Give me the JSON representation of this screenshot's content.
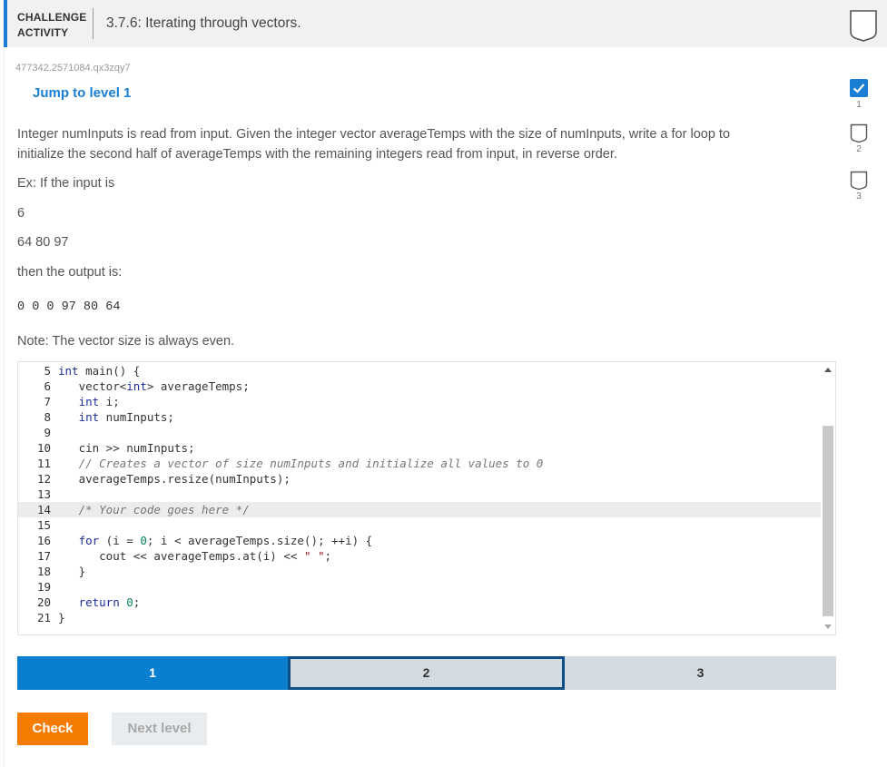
{
  "header": {
    "tag_line1": "CHALLENGE",
    "tag_line2": "ACTIVITY",
    "title": "3.7.6: Iterating through vectors."
  },
  "activity_id": "477342.2571084.qx3zqy7",
  "jump_link": "Jump to level 1",
  "instructions": {
    "p1_line1": "Integer numInputs is read from input. Given the integer vector averageTemps with the size of numInputs, write a for loop to",
    "p1_line2": "initialize the second half of averageTemps with the remaining integers read from input, in reverse order.",
    "example_intro": "Ex: If the input is",
    "input_line1": "6",
    "input_line2": "64 80 97",
    "output_intro": "then the output is:",
    "output_value": "0 0 0 97 80 64",
    "note": "Note: The vector size is always even."
  },
  "code_lines": [
    {
      "n": "5",
      "code": "int main() {"
    },
    {
      "n": "6",
      "code": "   vector<int> averageTemps;"
    },
    {
      "n": "7",
      "code": "   int i;"
    },
    {
      "n": "8",
      "code": "   int numInputs;"
    },
    {
      "n": "9",
      "code": ""
    },
    {
      "n": "10",
      "code": "   cin >> numInputs;"
    },
    {
      "n": "11",
      "code": "   // Creates a vector of size numInputs and initialize all values to 0"
    },
    {
      "n": "12",
      "code": "   averageTemps.resize(numInputs);"
    },
    {
      "n": "13",
      "code": ""
    },
    {
      "n": "14",
      "code": "   /* Your code goes here */"
    },
    {
      "n": "15",
      "code": ""
    },
    {
      "n": "16",
      "code": "   for (i = 0; i < averageTemps.size(); ++i) {"
    },
    {
      "n": "17",
      "code": "      cout << averageTemps.at(i) << \" \";"
    },
    {
      "n": "18",
      "code": "   }"
    },
    {
      "n": "19",
      "code": ""
    },
    {
      "n": "20",
      "code": "   return 0;"
    },
    {
      "n": "21",
      "code": "}"
    }
  ],
  "levels": [
    {
      "label": "1",
      "state": "done"
    },
    {
      "label": "2",
      "state": "current"
    },
    {
      "label": "3",
      "state": "todo"
    }
  ],
  "buttons": {
    "check": "Check",
    "next": "Next level"
  },
  "sidebar_levels": [
    {
      "label": "1",
      "state": "completed"
    },
    {
      "label": "2",
      "state": "incomplete"
    },
    {
      "label": "3",
      "state": "incomplete"
    }
  ],
  "colors": {
    "accent": "#1a7fd4",
    "level_done": "#0a7fd0",
    "level_current_border": "#0f4d85",
    "check_button": "#f57c00"
  }
}
